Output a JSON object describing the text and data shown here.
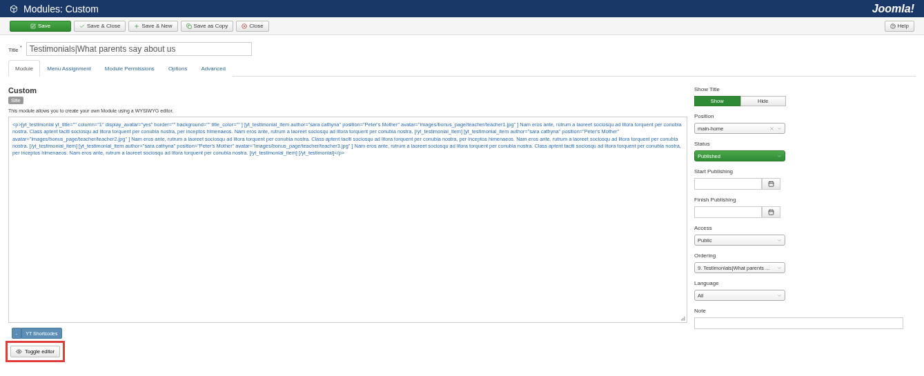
{
  "header": {
    "title": "Modules: Custom",
    "brand": "Joomla!"
  },
  "toolbar": {
    "buttons": [
      {
        "label": "Save",
        "kind": "primary"
      },
      {
        "label": "Save & Close",
        "kind": "check"
      },
      {
        "label": "Save & New",
        "kind": "plus"
      },
      {
        "label": "Save as Copy",
        "kind": "copy"
      },
      {
        "label": "Close",
        "kind": "close"
      }
    ],
    "help": "Help"
  },
  "title_field": {
    "label": "Title",
    "required_mark": "*",
    "value": "Testimonials|What parents say about us"
  },
  "tabs": [
    {
      "label": "Module",
      "selected": true
    },
    {
      "label": "Menu Assignment",
      "selected": false
    },
    {
      "label": "Module Permissions",
      "selected": false
    },
    {
      "label": "Options",
      "selected": false
    },
    {
      "label": "Advanced",
      "selected": false
    }
  ],
  "module": {
    "heading": "Custom",
    "badge": "Site",
    "description": "This module allows you to create your own Module using a WYSIWYG editor.",
    "editor_text": "<p>[yt_testimonial yt_title=\"\" column=\"1\" display_avatar=\"yes\" border=\"\" background=\"\" title_color=\"\" ] [yt_testimonial_item author=\"sara cathyna\" position=\"Peter's Mother\" avatar=\"images/bonus_page/teacher/teacher1.jpg\" ] Nam eros ante, rutrum a laoreet sociosqu ad litora torquent per conubia nostra. Class aptent taciti sociosqu ad litora torquent per conubia nostra, per inceptos himenaeos. Nam eros ante, rutrum a laoreet sociosqu ad litora torquent per conubia nostra. [/yt_testimonial_item] [yt_testimonial_item author=\"sara cathyna\" position=\"Peter's Mother\" avatar=\"images/bonus_page/teacher/teacher2.jpg\" ] Nam eros ante, rutrum a laoreet sociosqu ad litora torquent per conubia nostra. Class aptent taciti sociosqu ad litora torquent per conubia nostra, per inceptos himenaeos. Nam eros ante, rutrum a laoreet sociosqu ad litora torquent per conubia nostra. [/yt_testimonial_item] [yt_testimonial_item author=\"sara cathyna\" position=\"Peter's Mother\" avatar=\"images/bonus_page/teacher/teacher3.jpg\" ] Nam eros ante, rutrum a laoreet sociosqu ad litora torquent per conubia nostra. Class aptent taciti sociosqu ad litora torquent per conubia nostra, per inceptos himenaeos. Nam eros ante, rutrum a laoreet sociosqu ad litora torquent per conubia nostra. [/yt_testimonial_item] [/yt_testimonial]</p>",
    "shortcodes_toggle": "-",
    "shortcodes_button": "YT Shortcodes",
    "toggle_editor": "Toggle editor"
  },
  "sidebar": [
    {
      "kind": "toggle",
      "label": "Show Title",
      "options": [
        {
          "label": "Show",
          "selected": true
        },
        {
          "label": "Hide",
          "selected": false
        }
      ]
    },
    {
      "kind": "select",
      "label": "Position",
      "value": "main-home",
      "clearable": true,
      "published": false
    },
    {
      "kind": "select",
      "label": "Status",
      "value": "Published",
      "clearable": false,
      "published": true
    },
    {
      "kind": "date",
      "label": "Start Publishing"
    },
    {
      "kind": "date",
      "label": "Finish Publishing"
    },
    {
      "kind": "select",
      "label": "Access",
      "value": "Public",
      "clearable": false,
      "published": false
    },
    {
      "kind": "select",
      "label": "Ordering",
      "value": "9. Testimonials|What parents ...",
      "clearable": false,
      "published": false
    },
    {
      "kind": "select",
      "label": "Language",
      "value": "All",
      "clearable": false,
      "published": false
    },
    {
      "kind": "text",
      "label": "Note"
    }
  ]
}
